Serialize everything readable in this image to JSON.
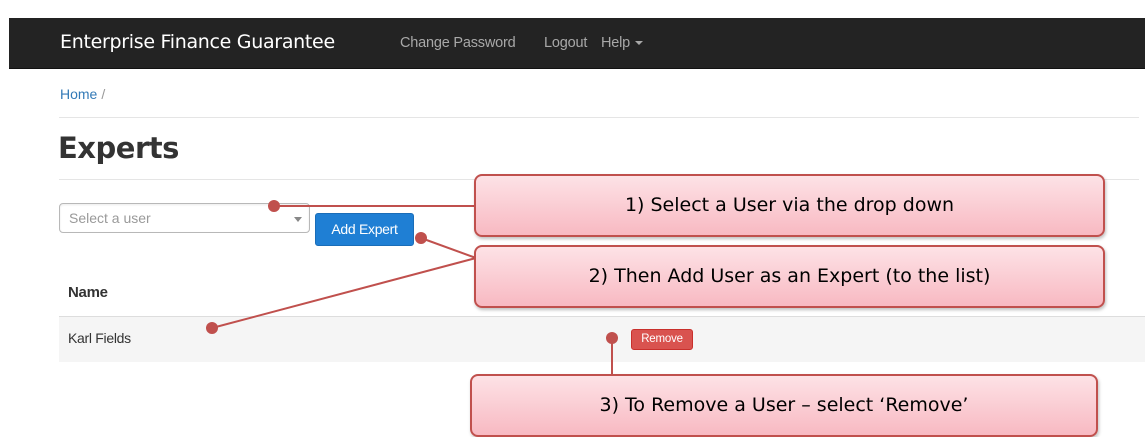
{
  "navbar": {
    "brand": "Enterprise Finance Guarantee",
    "links": [
      {
        "label": "Change Password"
      },
      {
        "label": "Logout"
      },
      {
        "label": "Help"
      }
    ]
  },
  "breadcrumb": {
    "home": "Home",
    "separator": "/"
  },
  "page": {
    "title": "Experts"
  },
  "user_select": {
    "placeholder": "Select a user"
  },
  "add_button": {
    "label": "Add Expert"
  },
  "table": {
    "headers": [
      "Name"
    ],
    "rows": [
      {
        "name": "Karl Fields",
        "action": "Remove"
      }
    ]
  },
  "callouts": [
    {
      "text": "1)  Select a User via the drop down"
    },
    {
      "text": "2)  Then Add User as an Expert (to the list)"
    },
    {
      "text": "3)  To Remove a User – select ‘Remove’"
    }
  ],
  "colors": {
    "navbar_bg": "#232323",
    "primary_button": "#1f7fd4",
    "danger_button": "#d9534f",
    "callout_border": "#c0504d",
    "callout_fill": "#f8b9c2",
    "link": "#337ab7"
  }
}
